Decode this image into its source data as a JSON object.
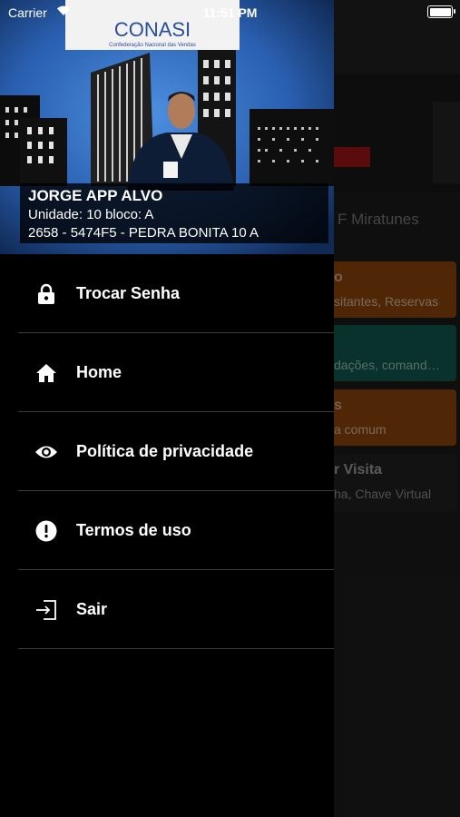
{
  "status_bar": {
    "carrier": "Carrier",
    "time": "11:51 PM",
    "battery_level": 1.0
  },
  "profile": {
    "name": "JORGE APP ALVO",
    "unit": "Unidade: 10 bloco: A",
    "code": "2658 - 5474F5 - PEDRA BONITA 10 A",
    "sign_text": "CONASI",
    "sign_subtext": "Confederação Nacional das Vendas"
  },
  "menu": {
    "items": [
      {
        "label": "Trocar Senha",
        "icon": "lock-icon"
      },
      {
        "label": "Home",
        "icon": "home-icon"
      },
      {
        "label": "Política de privacidade",
        "icon": "eye-icon"
      },
      {
        "label": "Termos de uso",
        "icon": "alert-circle-icon"
      },
      {
        "label": "Sair",
        "icon": "logout-icon"
      }
    ]
  },
  "background": {
    "title": "F Miratunes",
    "cards": [
      {
        "title": "o",
        "subtitle": "sitantes, Reservas",
        "color": "#7a3d0c"
      },
      {
        "title": "",
        "subtitle": "dações, comand…",
        "color": "#0d4d42"
      },
      {
        "title": "s",
        "subtitle": "a comum",
        "color": "#7a3d0c"
      },
      {
        "title": "r Visita",
        "subtitle": "ha, Chave Virtual",
        "color": "#1c1c1c"
      }
    ]
  }
}
